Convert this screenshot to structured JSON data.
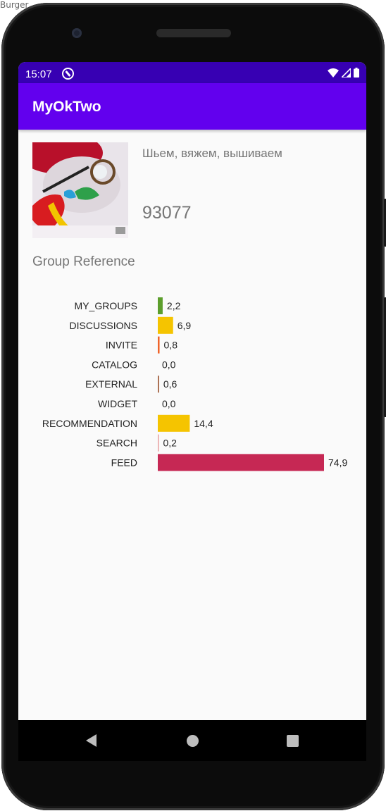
{
  "window_title": "Burger",
  "status_bar": {
    "time": "15:07",
    "icons": [
      "sync-icon",
      "wifi-icon",
      "signal-icon",
      "battery-icon"
    ]
  },
  "app_bar": {
    "title": "MyOkTwo"
  },
  "group": {
    "image_icon": "embroidery-photo",
    "name": "Шьем, вяжем, вышиваем",
    "count": "93077"
  },
  "section": {
    "label": "Group Reference"
  },
  "chart_data": {
    "type": "bar",
    "orientation": "horizontal",
    "categories": [
      "MY_GROUPS",
      "DISCUSSIONS",
      "INVITE",
      "CATALOG",
      "EXTERNAL",
      "WIDGET",
      "RECOMMENDATION",
      "SEARCH",
      "FEED"
    ],
    "values": [
      2.2,
      6.9,
      0.8,
      0.0,
      0.6,
      0.0,
      14.4,
      0.2,
      74.9
    ],
    "value_labels": [
      "2,2",
      "6,9",
      "0,8",
      "0,0",
      "0,6",
      "0,0",
      "14,4",
      "0,2",
      "74,9"
    ],
    "colors": [
      "#5c9e2c",
      "#f5c400",
      "#f0642a",
      "#c0c0c0",
      "#a86a4a",
      "#c0c0c0",
      "#f5c400",
      "#e8a0a0",
      "#c62854"
    ],
    "xlim": [
      0,
      74.9
    ],
    "grid": false,
    "legend": "none"
  },
  "nav_bar": {
    "icons": [
      "back-icon",
      "home-icon",
      "recent-apps-icon"
    ]
  }
}
